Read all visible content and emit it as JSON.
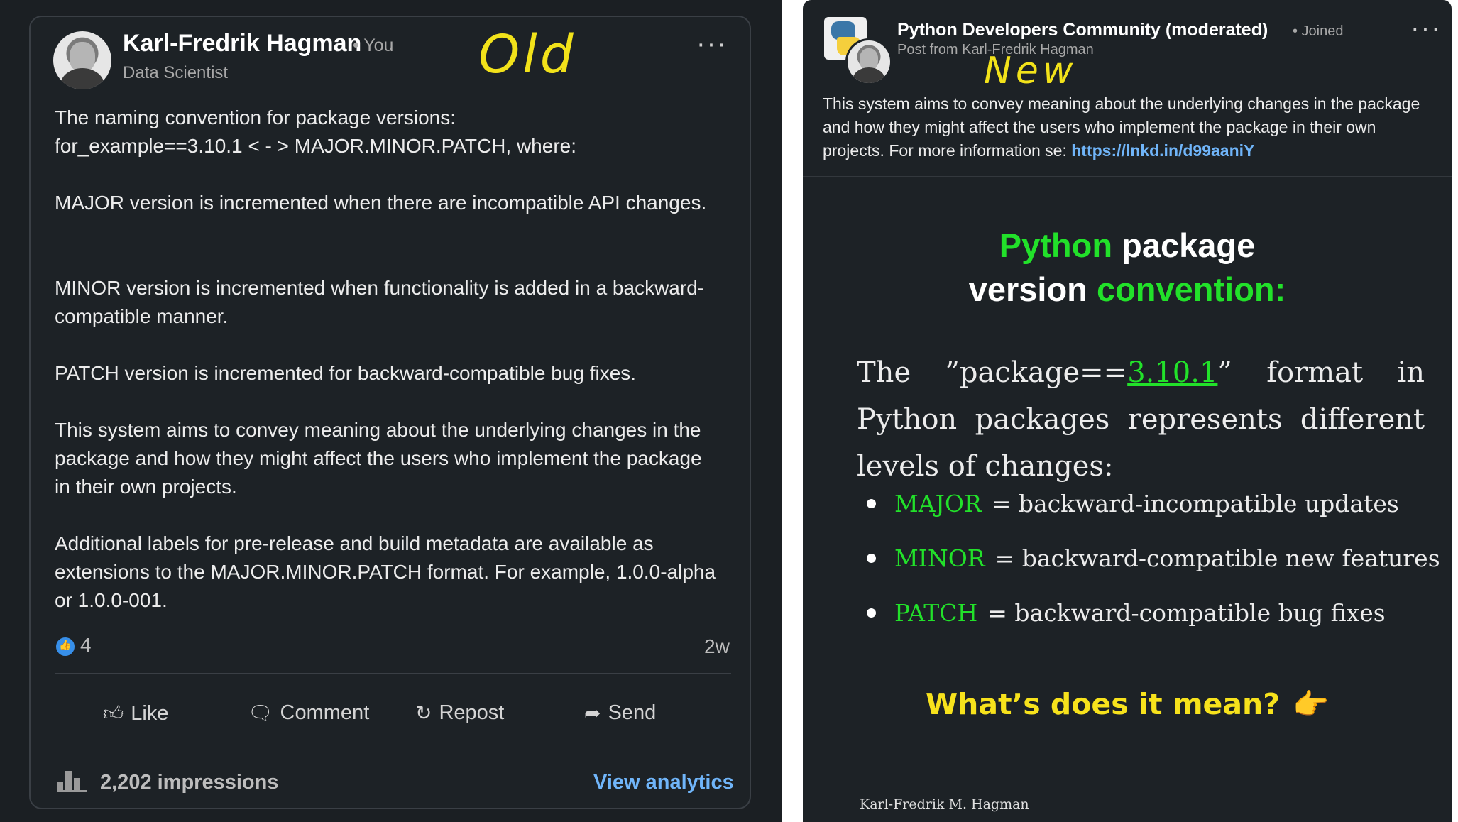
{
  "left": {
    "annotation": "Old",
    "author": "Karl-Fredrik Hagman",
    "you_badge": "• You",
    "headline": "Data Scientist",
    "more_icon": "ellipsis-icon",
    "paragraphs": [
      "The naming convention for package versions:\nfor_example==3.10.1 < - > MAJOR.MINOR.PATCH, where:",
      "MAJOR version is incremented when there are incompatible API changes.",
      "MINOR version is incremented when functionality is added in a backward-compatible manner.",
      "PATCH version is incremented for backward-compatible bug fixes.",
      "This system aims to convey meaning about the underlying changes in the package and how they might affect the users who implement the package in their own projects.",
      "Additional labels for pre-release and build metadata are available as extensions to the MAJOR.MINOR.PATCH format. For example, 1.0.0-alpha or 1.0.0-001."
    ],
    "reaction_count": "4",
    "age": "2w",
    "actions": [
      {
        "label": "Like",
        "icon": "thumbs-up-icon"
      },
      {
        "label": "Comment",
        "icon": "comment-icon"
      },
      {
        "label": "Repost",
        "icon": "repost-icon"
      },
      {
        "label": "Send",
        "icon": "send-icon"
      }
    ],
    "impressions": "2,202 impressions",
    "analytics_link": "View analytics",
    "colors": {
      "background": "#1b1f23",
      "link": "#70b5f9",
      "annotation": "#f2e21a"
    }
  },
  "right": {
    "annotation": "New",
    "group_name": "Python Developers Community (moderated)",
    "joined": "• Joined",
    "post_from": "Post from Karl-Fredrik Hagman",
    "description": "This system aims to convey meaning about the underlying changes in the package and how they might affect the users who implement the package in their own projects. For more information se: ",
    "link": "https://lnkd.in/d99aaniY",
    "slide": {
      "title_line1_green": "Python",
      "title_line1_white": "package",
      "title_line2_white": "version",
      "title_line2_green": "convention:",
      "intro_before": "The ”package==",
      "intro_version": "3.10.1",
      "intro_after": "”  format in Python packages represents different levels of changes:",
      "bullets": [
        {
          "key": "MAJOR",
          "desc": "= backward-incompatible updates"
        },
        {
          "key": "MINOR",
          "desc": "= backward-compatible new features"
        },
        {
          "key": "PATCH",
          "desc": "= backward-compatible bug fixes"
        }
      ],
      "cta": "What’s does it mean?",
      "cta_icon": "pointing-hand-icon",
      "footer": "Karl-Fredrik M. Hagman"
    },
    "colors": {
      "accent_green": "#22e12a",
      "cta_yellow": "#f7e21c"
    }
  }
}
